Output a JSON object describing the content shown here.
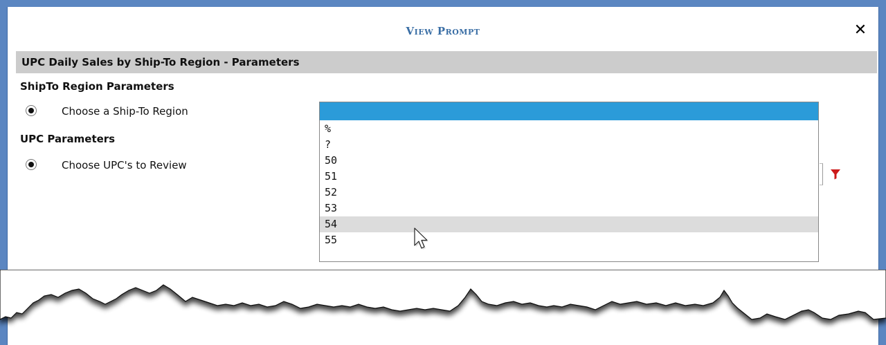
{
  "dialog": {
    "title": "View Prompt",
    "close_glyph": "✕"
  },
  "report": {
    "header": "UPC Daily Sales by Ship-To Region - Parameters"
  },
  "sections": [
    {
      "label": "ShipTo Region Parameters",
      "param": {
        "label": "Choose a Ship-To Region",
        "selected": true
      }
    },
    {
      "label": "UPC Parameters",
      "param": {
        "label": "Choose UPC's to Review",
        "selected": true
      }
    }
  ],
  "dropdown": {
    "selected_value": "",
    "options": [
      "%",
      "?",
      "50",
      "51",
      "52",
      "53",
      "54",
      "55"
    ],
    "hovered_option": "54"
  },
  "icons": {
    "filter": "filter-icon",
    "close": "close-icon",
    "cursor": "mouse-pointer-icon"
  },
  "colors": {
    "frame": "#5b86c1",
    "title": "#3a6ea5",
    "header_band": "#cccccc",
    "selection": "#2b9bd9",
    "hover": "#dcdcdc",
    "filter": "#cc1a1a"
  }
}
